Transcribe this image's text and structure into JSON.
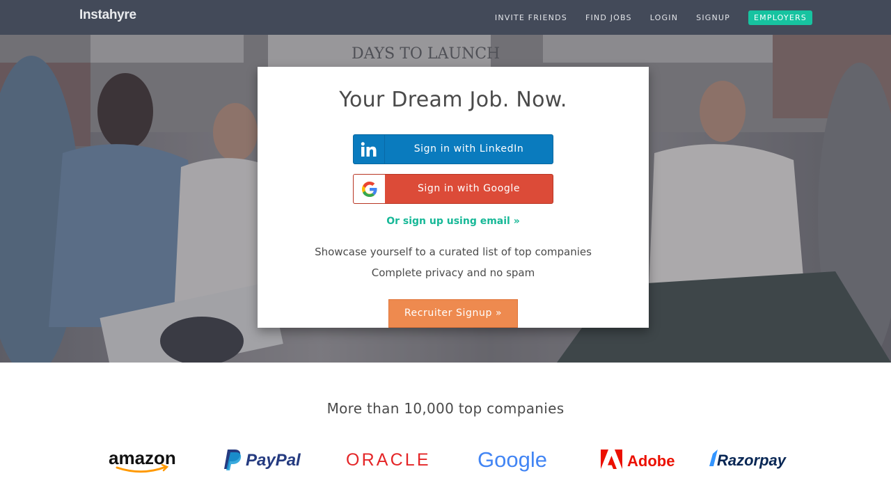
{
  "app": {
    "logo_text": "Instahyre"
  },
  "navbar": {
    "links": [
      {
        "label": "INVITE FRIENDS"
      },
      {
        "label": "FIND JOBS"
      },
      {
        "label": "LOGIN"
      },
      {
        "label": "SIGNUP"
      }
    ],
    "cta_label": "EMPLOYERS",
    "colors": {
      "background": "#434a59",
      "cta": "#17c3a0"
    }
  },
  "hero": {
    "background_text": "DAYS TO LAUNCH",
    "card": {
      "title": "Your Dream Job. Now.",
      "linkedin": {
        "label": "Sign in with LinkedIn",
        "icon": "linkedin-icon",
        "color": "#0a7bbe"
      },
      "google": {
        "label": "Sign in with Google",
        "icon": "google-icon",
        "color": "#dc4b38"
      },
      "email_link": "Or sign up using email »",
      "desc_1": "Showcase yourself to a curated list of top companies",
      "desc_2": "Complete privacy and no spam",
      "recruiter_button": "Recruiter Signup »",
      "recruiter_color": "#ee8a4f"
    }
  },
  "companies": {
    "title": "More than 10,000 top companies",
    "logos": [
      {
        "name": "amazon"
      },
      {
        "name": "PayPal"
      },
      {
        "name": "ORACLE"
      },
      {
        "name": "Google"
      },
      {
        "name": "Adobe"
      },
      {
        "name": "Razorpay"
      }
    ]
  }
}
